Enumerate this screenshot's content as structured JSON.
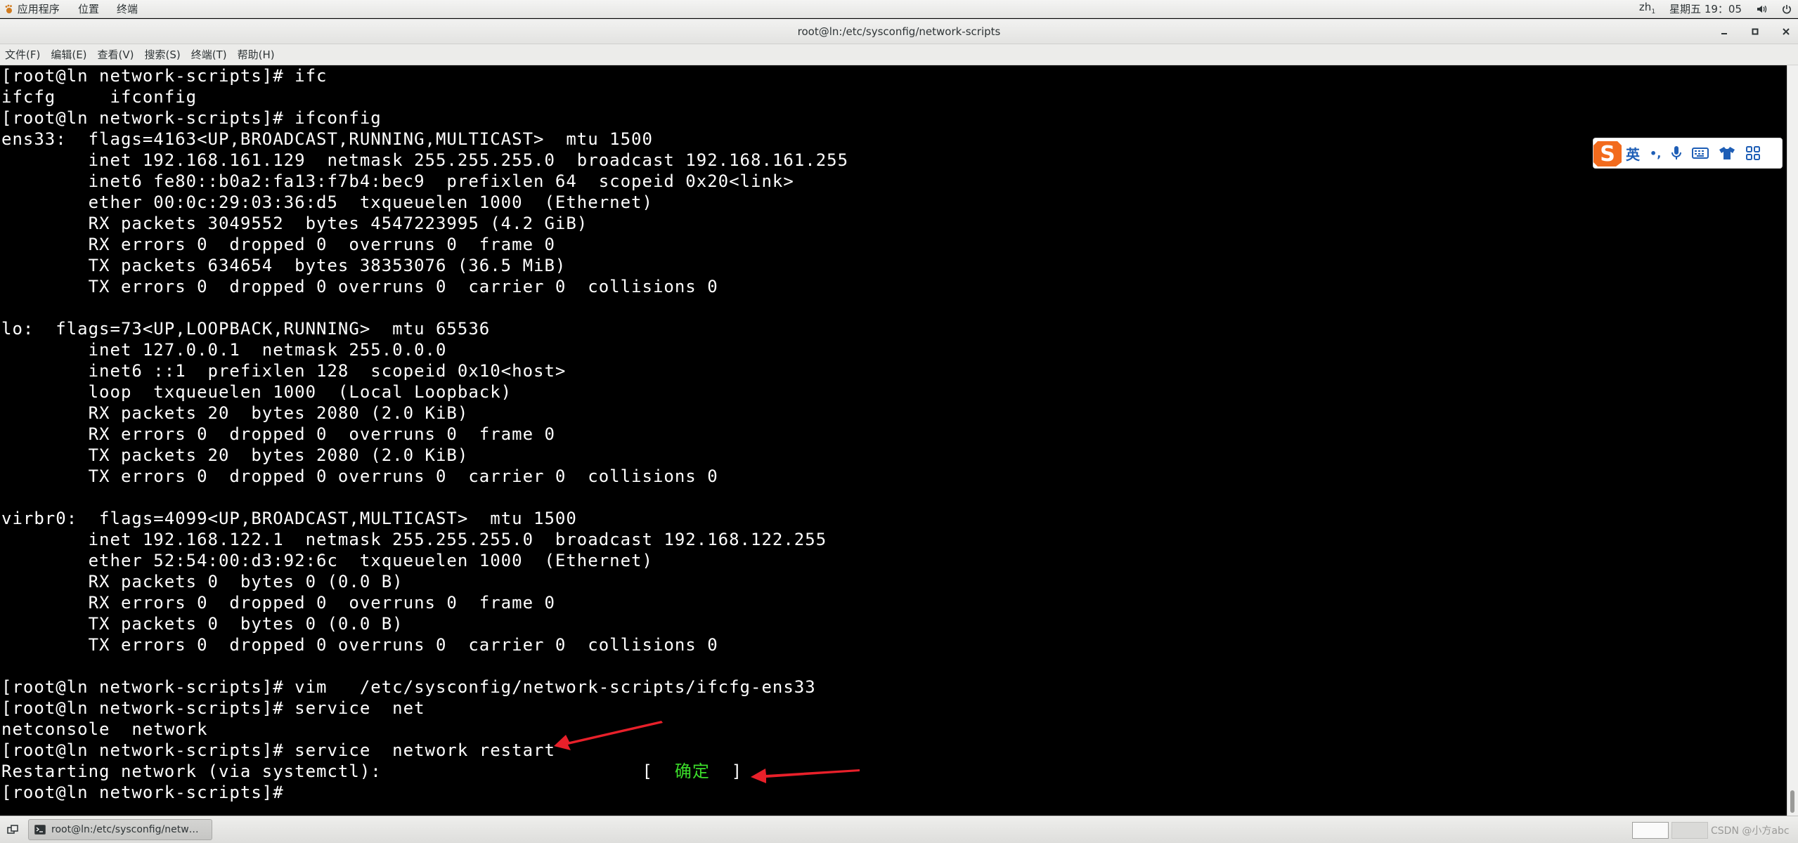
{
  "topbar": {
    "applications": "应用程序",
    "places": "位置",
    "terminal": "终端",
    "ime_indicator": "zh",
    "ime_indicator_sub": "1",
    "datetime": "星期五 19：05"
  },
  "window": {
    "title": "root@ln:/etc/sysconfig/network-scripts"
  },
  "menubar": {
    "file": "文件(F)",
    "edit": "编辑(E)",
    "view": "查看(V)",
    "search": "搜索(S)",
    "terminal": "终端(T)",
    "help": "帮助(H)"
  },
  "terminal": {
    "lines": [
      "[root@ln network-scripts]# ifc",
      "ifcfg     ifconfig",
      "[root@ln network-scripts]# ifconfig",
      "ens33:  flags=4163<UP,BROADCAST,RUNNING,MULTICAST>  mtu 1500",
      "        inet 192.168.161.129  netmask 255.255.255.0  broadcast 192.168.161.255",
      "        inet6 fe80::b0a2:fa13:f7b4:bec9  prefixlen 64  scopeid 0x20<link>",
      "        ether 00:0c:29:03:36:d5  txqueuelen 1000  (Ethernet)",
      "        RX packets 3049552  bytes 4547223995 (4.2 GiB)",
      "        RX errors 0  dropped 0  overruns 0  frame 0",
      "        TX packets 634654  bytes 38353076 (36.5 MiB)",
      "        TX errors 0  dropped 0 overruns 0  carrier 0  collisions 0",
      "",
      "lo:  flags=73<UP,LOOPBACK,RUNNING>  mtu 65536",
      "        inet 127.0.0.1  netmask 255.0.0.0",
      "        inet6 ::1  prefixlen 128  scopeid 0x10<host>",
      "        loop  txqueuelen 1000  (Local Loopback)",
      "        RX packets 20  bytes 2080 (2.0 KiB)",
      "        RX errors 0  dropped 0  overruns 0  frame 0",
      "        TX packets 20  bytes 2080 (2.0 KiB)",
      "        TX errors 0  dropped 0 overruns 0  carrier 0  collisions 0",
      "",
      "virbr0:  flags=4099<UP,BROADCAST,MULTICAST>  mtu 1500",
      "        inet 192.168.122.1  netmask 255.255.255.0  broadcast 192.168.122.255",
      "        ether 52:54:00:d3:92:6c  txqueuelen 1000  (Ethernet)",
      "        RX packets 0  bytes 0 (0.0 B)",
      "        RX errors 0  dropped 0  overruns 0  frame 0",
      "        TX packets 0  bytes 0 (0.0 B)",
      "        TX errors 0  dropped 0 overruns 0  carrier 0  collisions 0",
      "",
      "[root@ln network-scripts]# vim   /etc/sysconfig/network-scripts/ifcfg-ens33",
      "[root@ln network-scripts]# service  net",
      "netconsole  network",
      "[root@ln network-scripts]# service  network restart"
    ],
    "restart_prefix": "Restarting network (via systemctl):",
    "restart_padding": "                        ",
    "ok_open": "[  ",
    "ok_text": "确定",
    "ok_close": "  ]",
    "prompt": "[root@ln network-scripts]#"
  },
  "ime": {
    "lang": "英",
    "punct": "•,"
  },
  "taskbar": {
    "task_title": "root@ln:/etc/sysconfig/network-sc...",
    "watermark": "CSDN @小方abc"
  },
  "colors": {
    "terminal_bg": "#000000",
    "terminal_fg": "#ffffff",
    "ok_green": "#3bdc2a",
    "arrow_red": "#e8202a"
  }
}
